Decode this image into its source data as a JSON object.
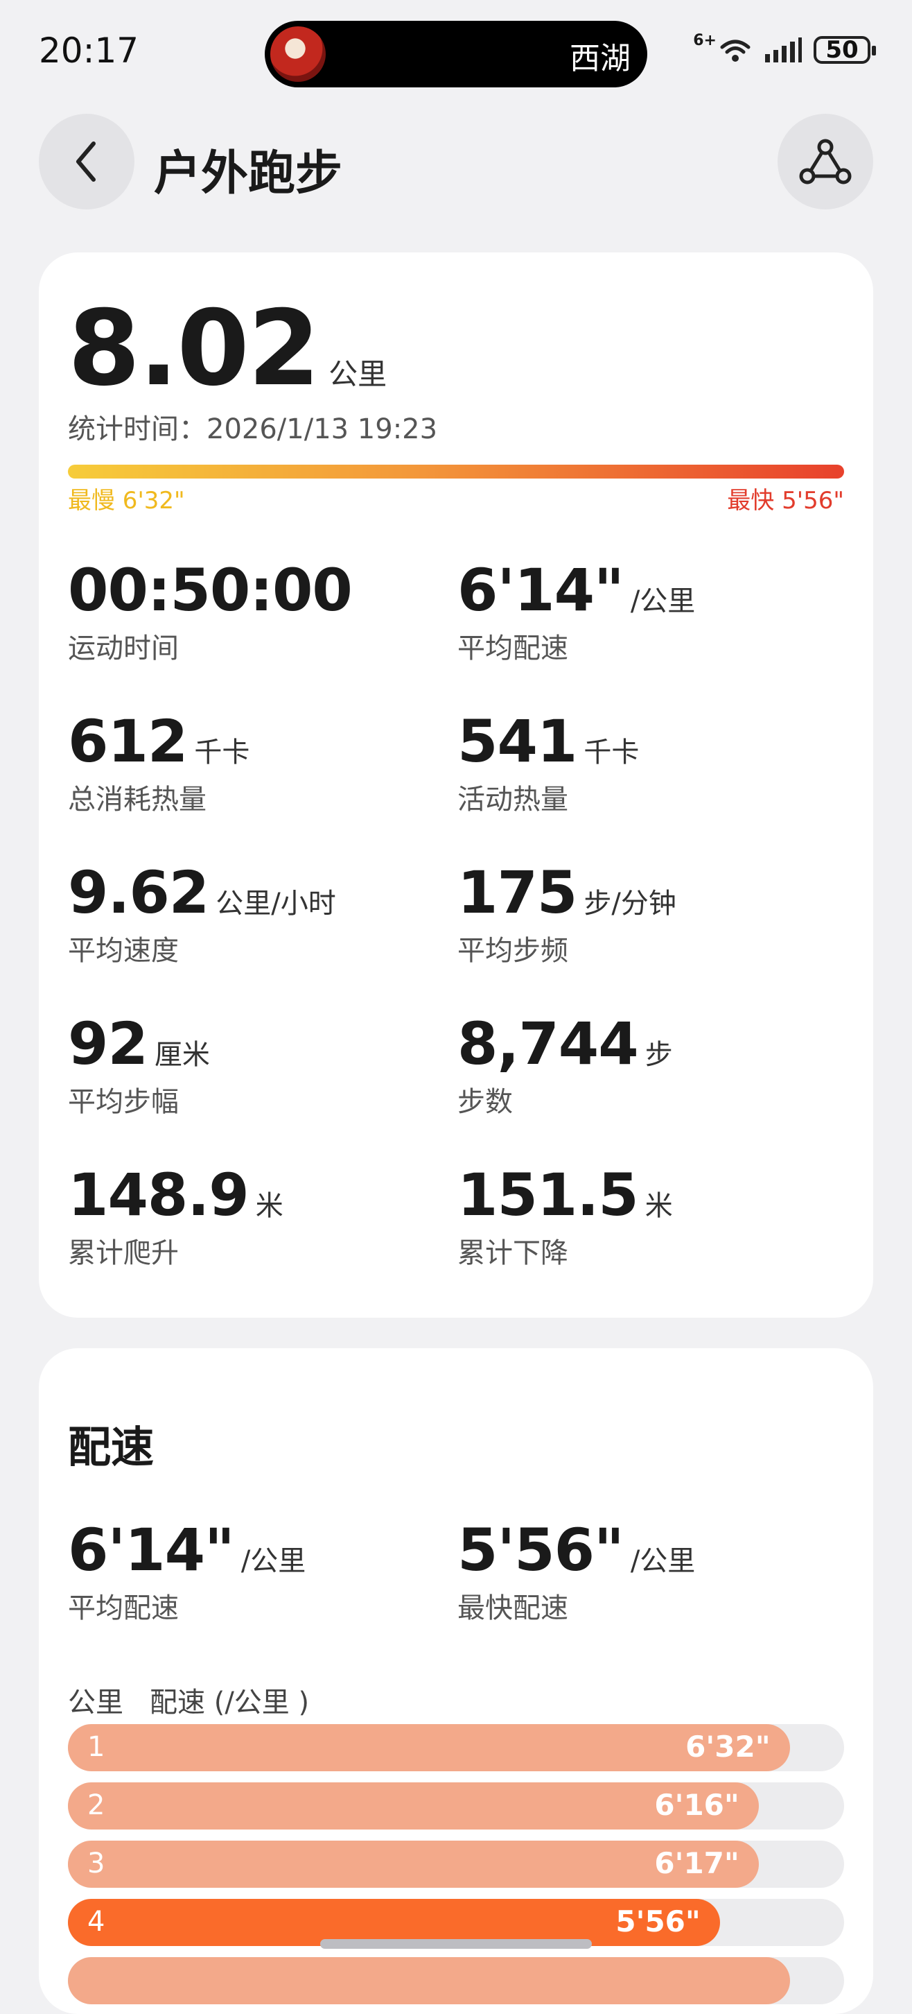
{
  "status_bar": {
    "time": "20:17",
    "island_text": "西湖",
    "battery": "50",
    "network_label": "6+",
    "icons": [
      "wifi-icon",
      "signal-icon",
      "battery-icon"
    ]
  },
  "header": {
    "title": "户外跑步",
    "back_icon": "chevron-left-icon",
    "route_icon": "route-icon"
  },
  "summary": {
    "distance": "8.02",
    "distance_unit": "公里",
    "stat_time": "统计时间：2026/1/13 19:23",
    "slowest_label": "最慢 6'32\"",
    "fastest_label": "最快 5'56\"",
    "gradient_colors": [
      "#f6cc3a",
      "#f3973a",
      "#e8412c"
    ]
  },
  "metrics": [
    {
      "value": "00:50:00",
      "unit": "",
      "label": "运动时间"
    },
    {
      "value": "6'14\"",
      "unit": "/公里",
      "label": "平均配速"
    },
    {
      "value": "612",
      "unit": "千卡",
      "label": "总消耗热量"
    },
    {
      "value": "541",
      "unit": "千卡",
      "label": "活动热量"
    },
    {
      "value": "9.62",
      "unit": "公里/小时",
      "label": "平均速度"
    },
    {
      "value": "175",
      "unit": "步/分钟",
      "label": "平均步频"
    },
    {
      "value": "92",
      "unit": "厘米",
      "label": "平均步幅"
    },
    {
      "value": "8,744",
      "unit": "步",
      "label": "步数"
    },
    {
      "value": "148.9",
      "unit": "米",
      "label": "累计爬升"
    },
    {
      "value": "151.5",
      "unit": "米",
      "label": "累计下降"
    }
  ],
  "pace_section": {
    "title": "配速",
    "avg_value": "6'14\"",
    "avg_unit": "/公里",
    "avg_label": "平均配速",
    "fast_value": "5'56\"",
    "fast_unit": "/公里",
    "fast_label": "最快配速",
    "col_km": "公里",
    "col_pace": "配速 (/公里 )",
    "bar_color": "#f3a98a",
    "fastest_bar_color": "#fa6b2a",
    "splits": [
      {
        "km": "1",
        "pace": "6'32\"",
        "fill": 0.93,
        "fastest": false
      },
      {
        "km": "2",
        "pace": "6'16\"",
        "fill": 0.89,
        "fastest": false
      },
      {
        "km": "3",
        "pace": "6'17\"",
        "fill": 0.89,
        "fastest": false
      },
      {
        "km": "4",
        "pace": "5'56\"",
        "fill": 0.84,
        "fastest": true
      }
    ]
  }
}
